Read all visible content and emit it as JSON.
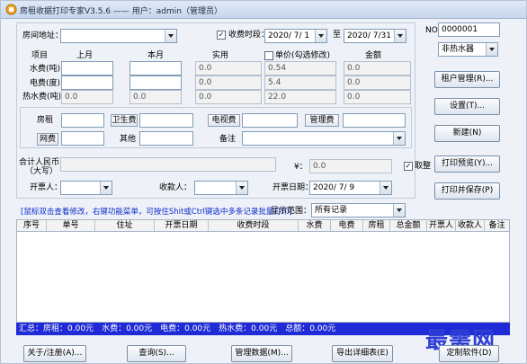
{
  "window": {
    "title": "房租收据打印专家V3.5.6 —— 用户：admin（管理员）"
  },
  "address": {
    "label": "房间地址：",
    "value": ""
  },
  "period": {
    "checkbox_label": "收费时段：",
    "checked": true,
    "from": "2020/ 7/ 1",
    "to_label": "至",
    "to": "2020/ 7/31"
  },
  "receipt_no": {
    "label": "NO",
    "value": "0000001"
  },
  "meter_table": {
    "headers": [
      "项目",
      "上月",
      "本月",
      "实用",
      "单价(勾选修改)",
      "金额"
    ],
    "rows": [
      {
        "label": "水费(吨)",
        "last": "",
        "current": "",
        "used": "0.0",
        "price": "0.54",
        "amount": "0.0"
      },
      {
        "label": "电费(度)",
        "last": "",
        "current": "",
        "used": "0.0",
        "price": "5.4",
        "amount": "0.0"
      },
      {
        "label": "热水费(吨)",
        "last": "0.0",
        "current": "0.0",
        "used": "0.0",
        "price": "22.0",
        "amount": "0.0"
      }
    ]
  },
  "fees": {
    "rent_label": "房租",
    "hygiene_label": "卫生费",
    "tv_label": "电视费",
    "mgmt_label": "管理费",
    "network_label": "网费",
    "other_label": "其他",
    "remark_label": "备注"
  },
  "total": {
    "label_line1": "合计人民币",
    "label_line2": "（大写）",
    "caps_value": "",
    "yen_label": "¥：",
    "value": "0.0",
    "round_label": "取整",
    "round_checked": true
  },
  "people": {
    "issuer_label": "开票人：",
    "issuer": "",
    "payee_label": "收款人：",
    "payee": "",
    "date_label": "开票日期：",
    "date": "2020/ 7/ 9"
  },
  "right_panel": {
    "water_mode": "非热水器",
    "tenant_btn": "租户管理(R)...",
    "settings_btn": "设置(T)...",
    "new_btn": "新建(N)",
    "preview_btn": "打印预览(Y)...",
    "print_save_btn": "打印并保存(P)"
  },
  "hint": "[鼠标双击查看修改，右键功能菜单，可按住Shit或Ctrl键选中多条记录批量打印]",
  "display_range": {
    "label": "显示范围：",
    "value": "所有记录"
  },
  "grid": {
    "columns": [
      "序号",
      "单号",
      "住址",
      "开票日期",
      "收费时段",
      "水费",
      "电费",
      "房租",
      "总金额",
      "开票人",
      "收款人",
      "备注"
    ]
  },
  "summary": {
    "prefix": "汇总：",
    "items": [
      "房租：0.00元",
      "水费：0.00元",
      "电费：0.00元",
      "热水费：0.00元",
      "总额：0.00元"
    ]
  },
  "bottom_buttons": {
    "about": "关于/注册(A)...",
    "query": "查询(S)...",
    "data_mgmt": "管理数据(M)...",
    "export": "导出详细表(E)",
    "custom": "定制软件(D)"
  },
  "watermark": "最需网",
  "colors": {
    "accent": "#1f2bd6",
    "hint": "#0a2acb",
    "window_bg": "#eef1f7"
  }
}
